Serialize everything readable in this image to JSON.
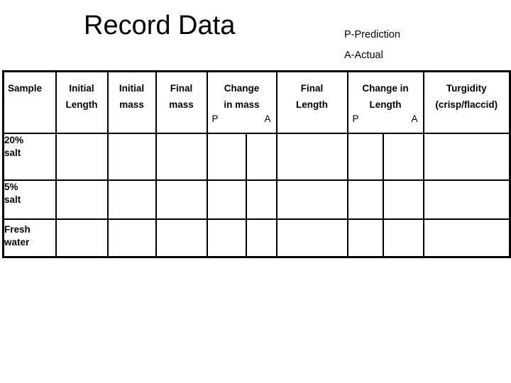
{
  "document": {
    "title": "Record Data",
    "legend": [
      "P-Prediction",
      "A-Actual"
    ]
  },
  "table": {
    "headers": {
      "sample": "Sample",
      "initial_length_l1": "Initial",
      "initial_length_l2": "Length",
      "initial_mass_l1": "Initial",
      "initial_mass_l2": "mass",
      "final_mass_l1": "Final",
      "final_mass_l2": "mass",
      "change_in_mass_l1": "Change",
      "change_in_mass_l2": "in mass",
      "change_in_mass_p": "P",
      "change_in_mass_a": "A",
      "final_length_l1": "Final",
      "final_length_l2": "Length",
      "change_in_length_l1": "Change in",
      "change_in_length_l2": "Length",
      "change_in_length_p": "P",
      "change_in_length_a": "A",
      "turgidity_l1": "Turgidity",
      "turgidity_l2": "(crisp/flaccid)"
    },
    "rows": [
      {
        "label_l1": "20%",
        "label_l2": "salt",
        "initial_length": "",
        "initial_mass": "",
        "final_mass": "",
        "change_in_mass_p": "",
        "change_in_mass_a": "",
        "final_length": "",
        "change_in_length_p": "",
        "change_in_length_a": "",
        "turgidity": ""
      },
      {
        "label_l1": "5%",
        "label_l2": "salt",
        "initial_length": "",
        "initial_mass": "",
        "final_mass": "",
        "change_in_mass_p": "",
        "change_in_mass_a": "",
        "final_length": "",
        "change_in_length_p": "",
        "change_in_length_a": "",
        "turgidity": ""
      },
      {
        "label_l1": "Fresh",
        "label_l2": "water",
        "initial_length": "",
        "initial_mass": "",
        "final_mass": "",
        "change_in_mass_p": "",
        "change_in_mass_a": "",
        "final_length": "",
        "change_in_length_p": "",
        "change_in_length_a": "",
        "turgidity": ""
      }
    ]
  }
}
